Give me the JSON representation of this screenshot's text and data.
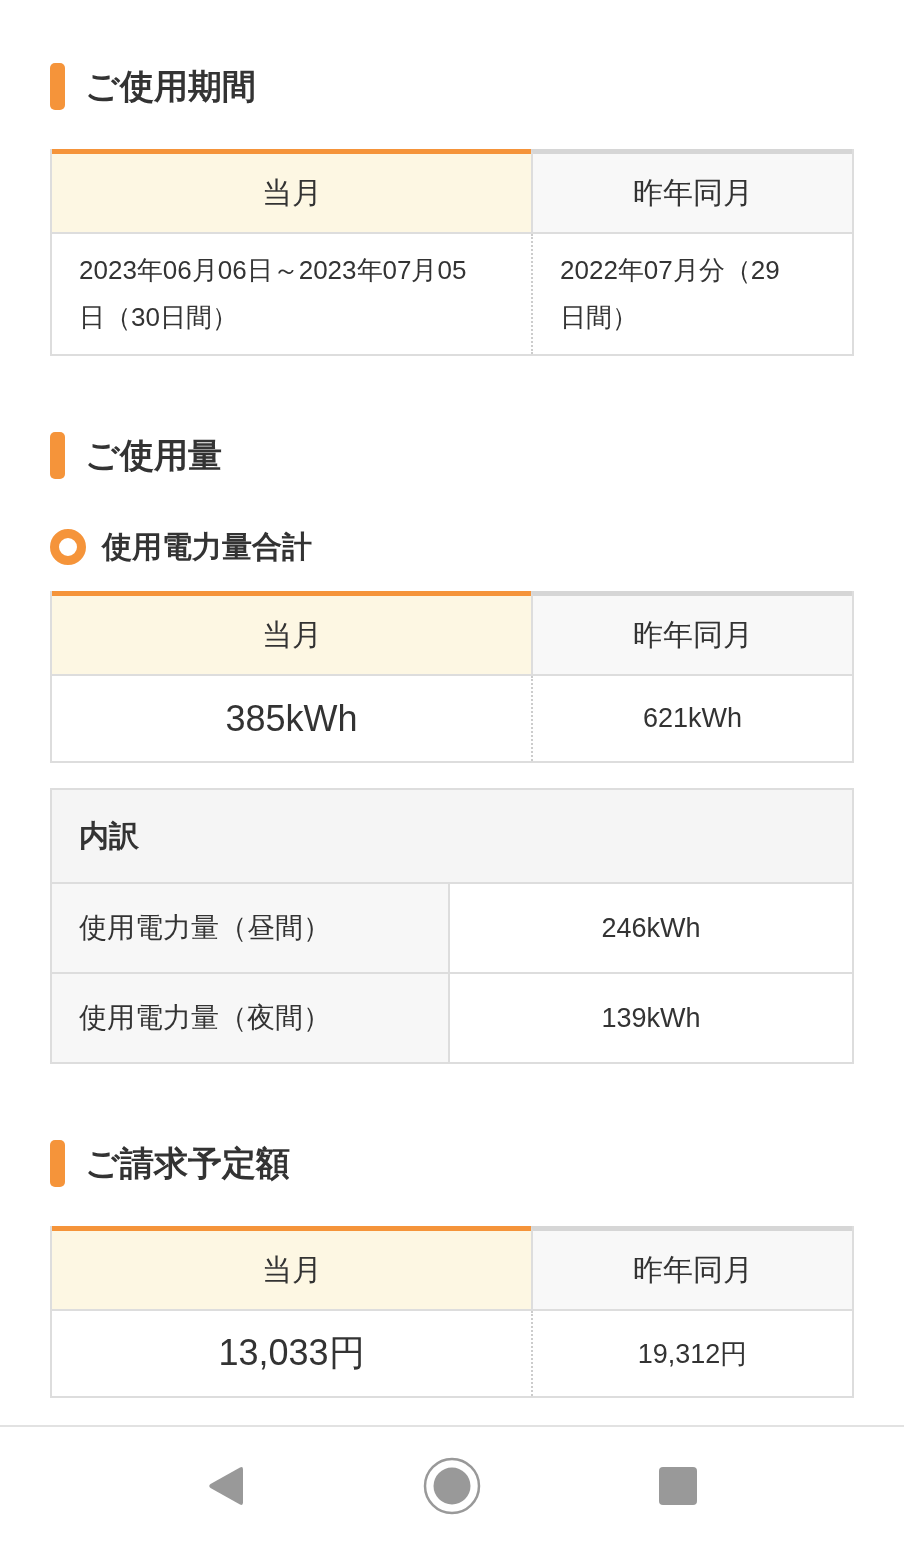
{
  "sections": [
    {
      "title": "ご使用期間",
      "blocks": [
        {
          "kind": "period",
          "columns": [
            {
              "label": "当月",
              "highlighted": true,
              "value": "2023年06月06日～2023年07月05日（30日間）"
            },
            {
              "label": "昨年同月",
              "highlighted": false,
              "value": "2022年07月分（29日間）"
            }
          ]
        }
      ]
    },
    {
      "title": "ご使用量",
      "blocks": [
        {
          "kind": "subheading",
          "text": "使用電力量合計"
        },
        {
          "kind": "comparison",
          "columns": [
            {
              "label": "当月",
              "highlighted": true,
              "value": "385kWh"
            },
            {
              "label": "昨年同月",
              "highlighted": false,
              "value": "621kWh"
            }
          ]
        },
        {
          "kind": "breakdown",
          "title": "内訳",
          "rows": [
            {
              "label": "使用電力量（昼間）",
              "value": "246kWh"
            },
            {
              "label": "使用電力量（夜間）",
              "value": "139kWh"
            }
          ]
        }
      ]
    },
    {
      "title": "ご請求予定額",
      "blocks": [
        {
          "kind": "comparison",
          "columns": [
            {
              "label": "当月",
              "highlighted": true,
              "value": "13,033円"
            },
            {
              "label": "昨年同月",
              "highlighted": false,
              "value": "19,312円"
            }
          ]
        }
      ]
    }
  ]
}
